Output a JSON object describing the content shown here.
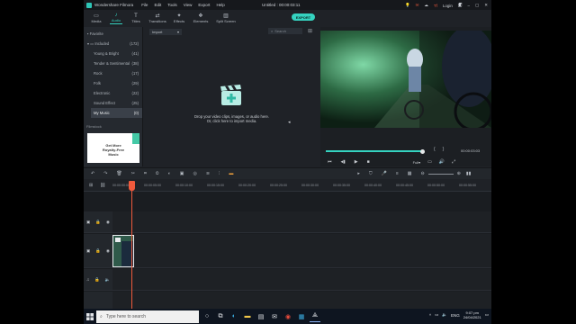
{
  "titlebar": {
    "app_name": "Wondershare Filmora",
    "menus": [
      "File",
      "Edit",
      "Tools",
      "View",
      "Export",
      "Help"
    ],
    "project_title": "Untitled : 00:00:03:11",
    "login": "Login",
    "window_controls": [
      "minimize",
      "maximize",
      "close"
    ]
  },
  "toolbar": {
    "tabs": [
      {
        "label": "Media",
        "icon": "folder-icon"
      },
      {
        "label": "Audio",
        "icon": "music-note-icon"
      },
      {
        "label": "Titles",
        "icon": "text-t-icon"
      },
      {
        "label": "Transitions",
        "icon": "transitions-icon"
      },
      {
        "label": "Effects",
        "icon": "effects-icon"
      },
      {
        "label": "Elements",
        "icon": "elements-icon"
      },
      {
        "label": "Split Screen",
        "icon": "split-screen-icon"
      }
    ],
    "active_tab": "Audio",
    "export_label": "EXPORT"
  },
  "sidebar": {
    "items": [
      {
        "label": "Favorite",
        "count": ""
      },
      {
        "label": "Included",
        "count": "(172)"
      },
      {
        "label": "Young & Bright",
        "count": "(41)"
      },
      {
        "label": "Tender & Sentimental",
        "count": "(38)"
      },
      {
        "label": "Rock",
        "count": "(17)"
      },
      {
        "label": "Folk",
        "count": "(29)"
      },
      {
        "label": "Electronic",
        "count": "(22)"
      },
      {
        "label": "Sound Effect",
        "count": "(25)"
      },
      {
        "label": "My Music",
        "count": "(0)"
      }
    ],
    "ad_label": "Filmstock",
    "ad_text": "Get More Royalty-Free Music"
  },
  "media": {
    "import_label": "Import",
    "search_placeholder": "Search",
    "drop_line1": "Drop your video clips, images, or audio here.",
    "drop_line2": "Or, click here to import media."
  },
  "preview": {
    "timecode": "00:00:03:03",
    "quality": "Full"
  },
  "ruler": {
    "ticks": [
      "00:00:00:00",
      "00:00:05:00",
      "00:00:10:00",
      "00:00:15:00",
      "00:00:20:00",
      "00:00:25:00",
      "00:00:30:00",
      "00:00:35:00",
      "00:00:40:00",
      "00:00:45:00",
      "00:00:50:00",
      "00:00:55:00"
    ]
  },
  "taskbar": {
    "search_placeholder": "Type here to search",
    "time": "9:07 pm",
    "date": "24/04/2021",
    "language": "ENG"
  },
  "colors": {
    "accent": "#35d3c0",
    "playhead": "#f05a3c",
    "background": "#1f2227"
  }
}
